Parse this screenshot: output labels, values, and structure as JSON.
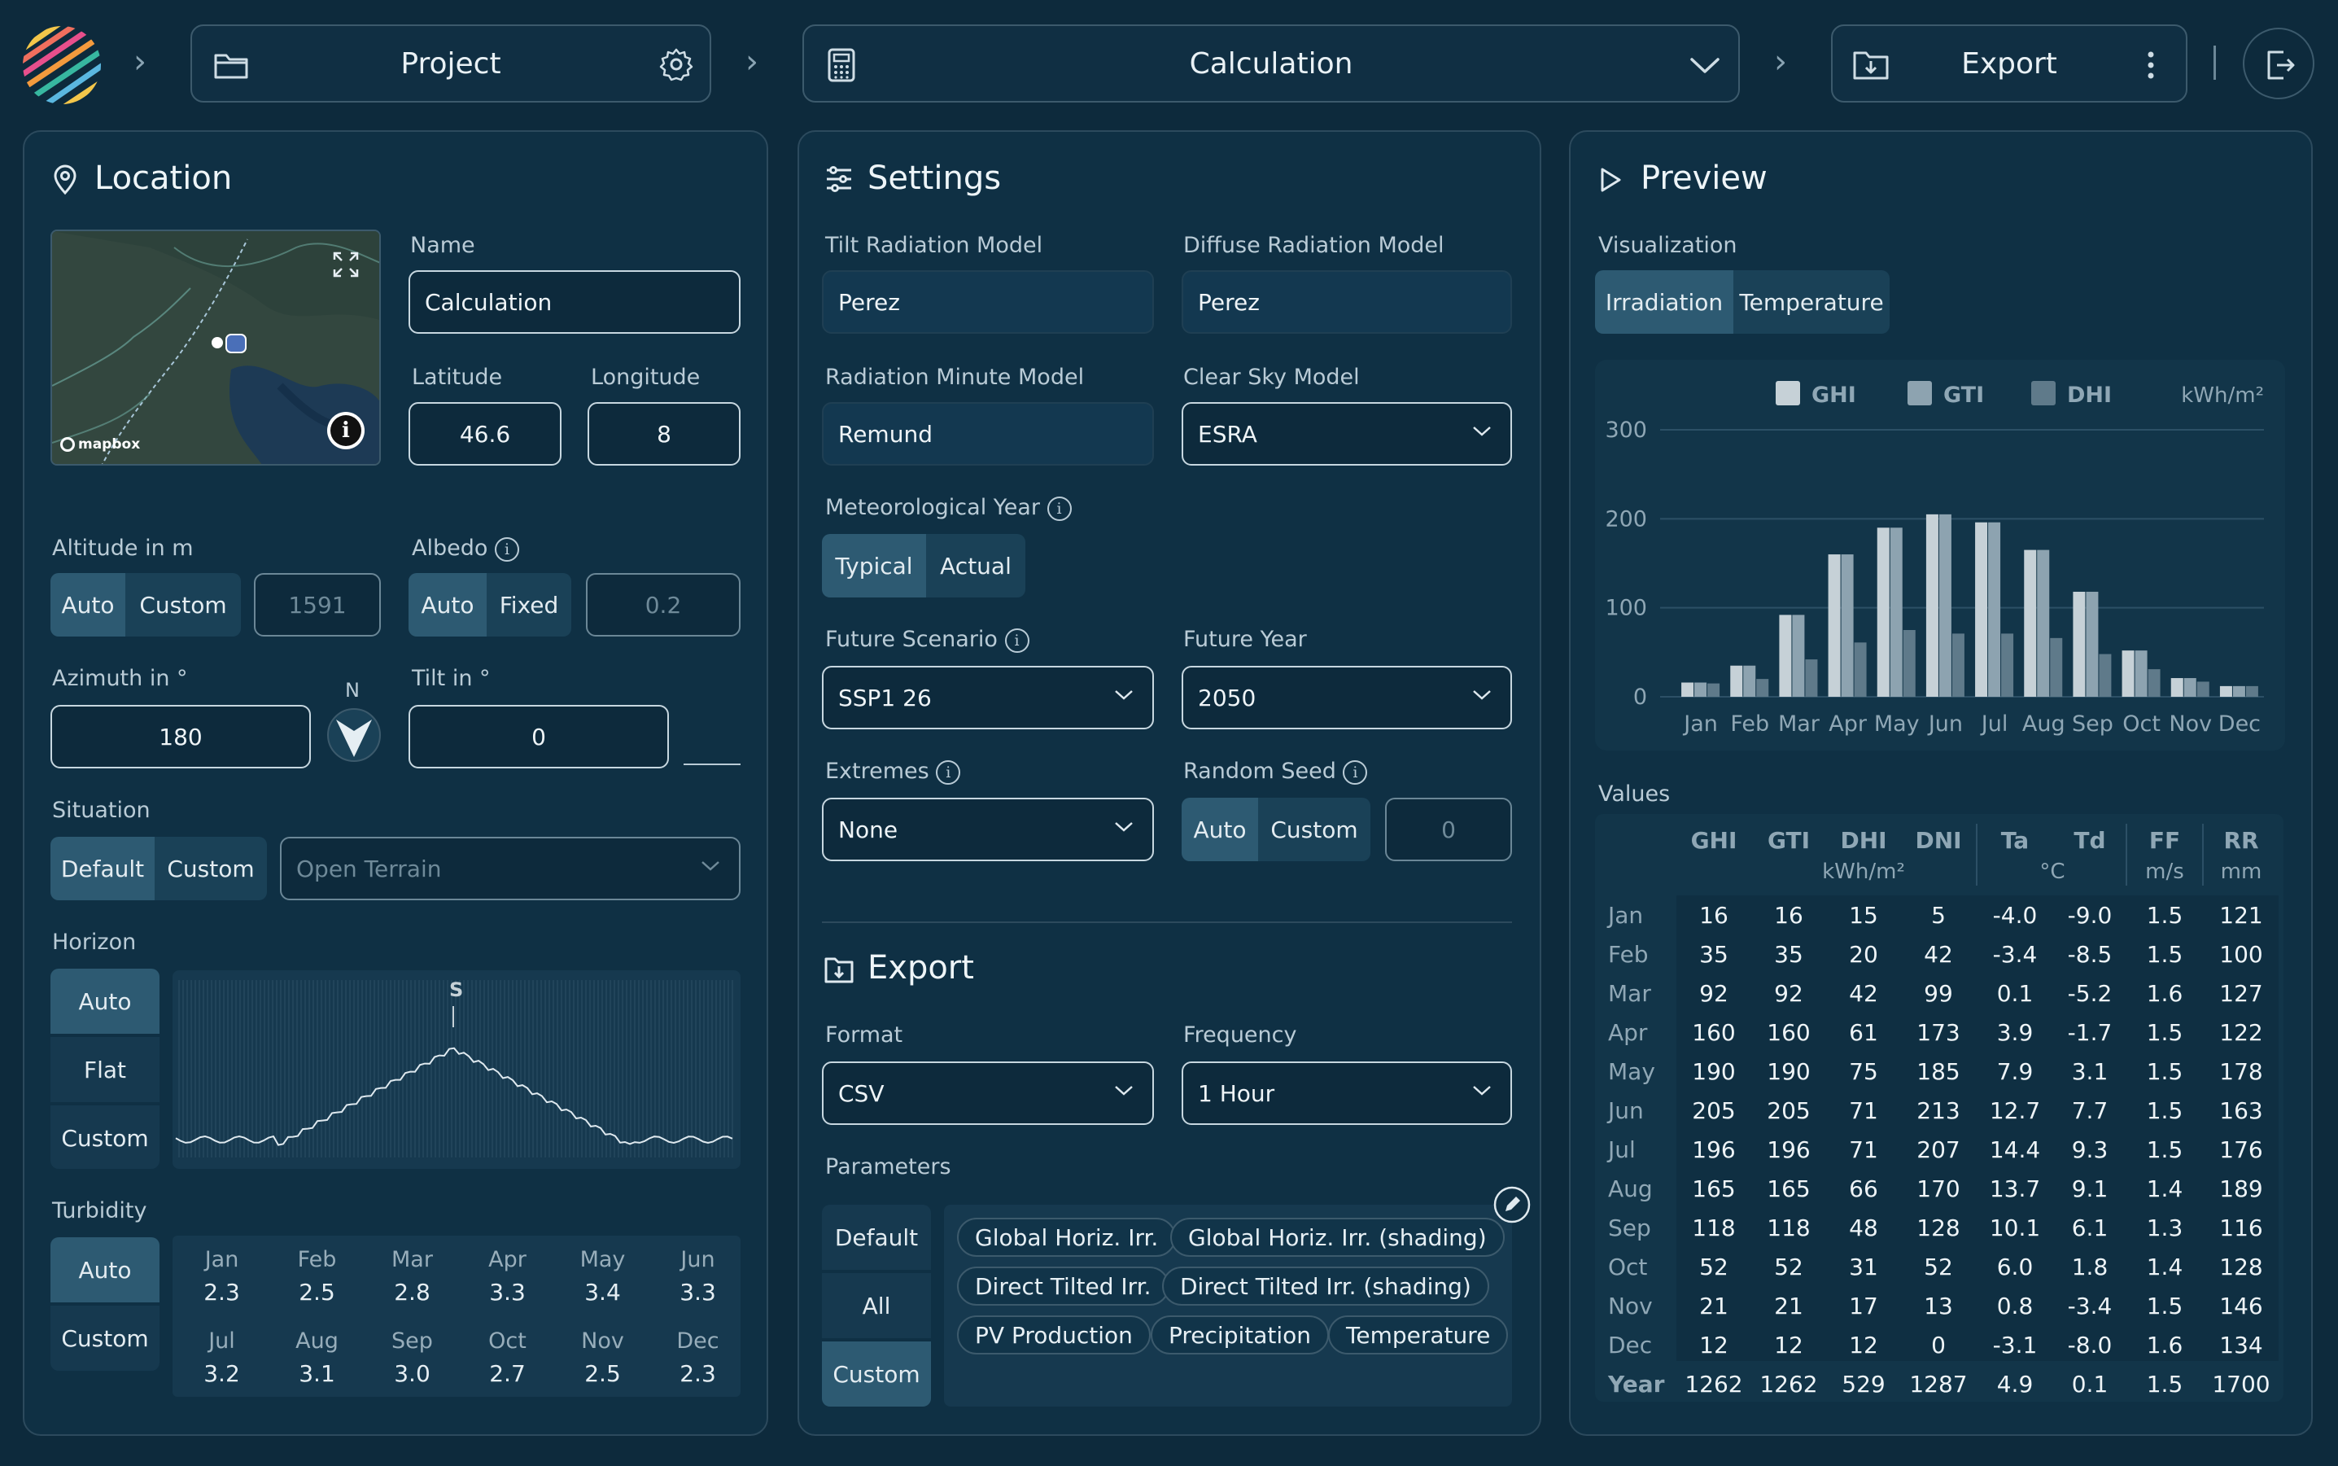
{
  "header": {
    "project_label": "Project",
    "calculation_label": "Calculation",
    "export_label": "Export"
  },
  "location": {
    "title": "Location",
    "map_attribution": "mapbox",
    "name_label": "Name",
    "name_value": "Calculation",
    "latitude_label": "Latitude",
    "latitude_value": "46.6",
    "longitude_label": "Longitude",
    "longitude_value": "8",
    "altitude_label": "Altitude in m",
    "altitude_options": [
      "Auto",
      "Custom"
    ],
    "altitude_value": "1591",
    "albedo_label": "Albedo",
    "albedo_options": [
      "Auto",
      "Fixed"
    ],
    "albedo_value": "0.2",
    "azimuth_label": "Azimuth in °",
    "azimuth_value": "180",
    "compass_label": "N",
    "tilt_label": "Tilt in °",
    "tilt_value": "0",
    "situation_label": "Situation",
    "situation_options": [
      "Default",
      "Custom"
    ],
    "situation_value": "Open Terrain",
    "horizon_label": "Horizon",
    "horizon_options": [
      "Auto",
      "Flat",
      "Custom"
    ],
    "horizon_marker": "S",
    "turbidity_label": "Turbidity",
    "turbidity_options": [
      "Auto",
      "Custom"
    ],
    "turbidity": [
      {
        "m": "Jan",
        "v": "2.3"
      },
      {
        "m": "Feb",
        "v": "2.5"
      },
      {
        "m": "Mar",
        "v": "2.8"
      },
      {
        "m": "Apr",
        "v": "3.3"
      },
      {
        "m": "May",
        "v": "3.4"
      },
      {
        "m": "Jun",
        "v": "3.3"
      },
      {
        "m": "Jul",
        "v": "3.2"
      },
      {
        "m": "Aug",
        "v": "3.1"
      },
      {
        "m": "Sep",
        "v": "3.0"
      },
      {
        "m": "Oct",
        "v": "2.7"
      },
      {
        "m": "Nov",
        "v": "2.5"
      },
      {
        "m": "Dec",
        "v": "2.3"
      }
    ]
  },
  "settings": {
    "title": "Settings",
    "tilt_model_label": "Tilt Radiation Model",
    "tilt_model_value": "Perez",
    "diffuse_model_label": "Diffuse Radiation Model",
    "diffuse_model_value": "Perez",
    "minute_model_label": "Radiation Minute Model",
    "minute_model_value": "Remund",
    "clearsky_label": "Clear Sky Model",
    "clearsky_value": "ESRA",
    "met_year_label": "Meteorological Year",
    "met_year_options": [
      "Typical",
      "Actual"
    ],
    "future_scenario_label": "Future Scenario",
    "future_scenario_value": "SSP1 26",
    "future_year_label": "Future Year",
    "future_year_value": "2050",
    "extremes_label": "Extremes",
    "extremes_value": "None",
    "seed_label": "Random Seed",
    "seed_options": [
      "Auto",
      "Custom"
    ],
    "seed_value": "0"
  },
  "export": {
    "title": "Export",
    "format_label": "Format",
    "format_value": "CSV",
    "frequency_label": "Frequency",
    "frequency_value": "1 Hour",
    "parameters_label": "Parameters",
    "param_options": [
      "Default",
      "All",
      "Custom"
    ],
    "chips": [
      "Global Horiz. Irr.",
      "Global Horiz. Irr. (shading)",
      "Direct Tilted Irr.",
      "Direct Tilted Irr. (shading)",
      "PV Production",
      "Precipitation",
      "Temperature"
    ]
  },
  "preview": {
    "title": "Preview",
    "visualization_label": "Visualization",
    "viz_options": [
      "Irradiation",
      "Temperature"
    ],
    "values_label": "Values",
    "table_headers": [
      "GHI",
      "GTI",
      "DHI",
      "DNI",
      "Ta",
      "Td",
      "FF",
      "RR"
    ],
    "table_unit_kwh": "kWh/m²",
    "table_unit_c": "°C",
    "table_unit_ms": "m/s",
    "table_unit_mm": "mm",
    "rows": [
      {
        "m": "Jan",
        "v": [
          "16",
          "16",
          "15",
          "5",
          "-4.0",
          "-9.0",
          "1.5",
          "121"
        ]
      },
      {
        "m": "Feb",
        "v": [
          "35",
          "35",
          "20",
          "42",
          "-3.4",
          "-8.5",
          "1.5",
          "100"
        ]
      },
      {
        "m": "Mar",
        "v": [
          "92",
          "92",
          "42",
          "99",
          "0.1",
          "-5.2",
          "1.6",
          "127"
        ]
      },
      {
        "m": "Apr",
        "v": [
          "160",
          "160",
          "61",
          "173",
          "3.9",
          "-1.7",
          "1.5",
          "122"
        ]
      },
      {
        "m": "May",
        "v": [
          "190",
          "190",
          "75",
          "185",
          "7.9",
          "3.1",
          "1.5",
          "178"
        ]
      },
      {
        "m": "Jun",
        "v": [
          "205",
          "205",
          "71",
          "213",
          "12.7",
          "7.7",
          "1.5",
          "163"
        ]
      },
      {
        "m": "Jul",
        "v": [
          "196",
          "196",
          "71",
          "207",
          "14.4",
          "9.3",
          "1.5",
          "176"
        ]
      },
      {
        "m": "Aug",
        "v": [
          "165",
          "165",
          "66",
          "170",
          "13.7",
          "9.1",
          "1.4",
          "189"
        ]
      },
      {
        "m": "Sep",
        "v": [
          "118",
          "118",
          "48",
          "128",
          "10.1",
          "6.1",
          "1.3",
          "116"
        ]
      },
      {
        "m": "Oct",
        "v": [
          "52",
          "52",
          "31",
          "52",
          "6.0",
          "1.8",
          "1.4",
          "128"
        ]
      },
      {
        "m": "Nov",
        "v": [
          "21",
          "21",
          "17",
          "13",
          "0.8",
          "-3.4",
          "1.5",
          "146"
        ]
      },
      {
        "m": "Dec",
        "v": [
          "12",
          "12",
          "12",
          "0",
          "-3.1",
          "-8.0",
          "1.6",
          "134"
        ]
      }
    ],
    "year_row": {
      "m": "Year",
      "v": [
        "1262",
        "1262",
        "529",
        "1287",
        "4.9",
        "0.1",
        "1.5",
        "1700"
      ]
    }
  },
  "chart_data": {
    "type": "bar",
    "categories": [
      "Jan",
      "Feb",
      "Mar",
      "Apr",
      "May",
      "Jun",
      "Jul",
      "Aug",
      "Sep",
      "Oct",
      "Nov",
      "Dec"
    ],
    "series": [
      {
        "name": "GHI",
        "values": [
          16,
          35,
          92,
          160,
          190,
          205,
          196,
          165,
          118,
          52,
          21,
          12
        ],
        "color": "#c6d1d7"
      },
      {
        "name": "GTI",
        "values": [
          16,
          35,
          92,
          160,
          190,
          205,
          196,
          165,
          118,
          52,
          21,
          12
        ],
        "color": "#8da3b0"
      },
      {
        "name": "DHI",
        "values": [
          15,
          20,
          42,
          61,
          75,
          71,
          71,
          66,
          48,
          31,
          17,
          12
        ],
        "color": "#5f7a8a"
      }
    ],
    "unit": "kWh/m²",
    "yticks": [
      0,
      100,
      200,
      300
    ],
    "ylim": [
      0,
      300
    ],
    "grid": true,
    "legend": "top"
  },
  "colors": {
    "background": "#0d2a3c",
    "panel": "#0f3044",
    "accent": "#2d5a72"
  }
}
